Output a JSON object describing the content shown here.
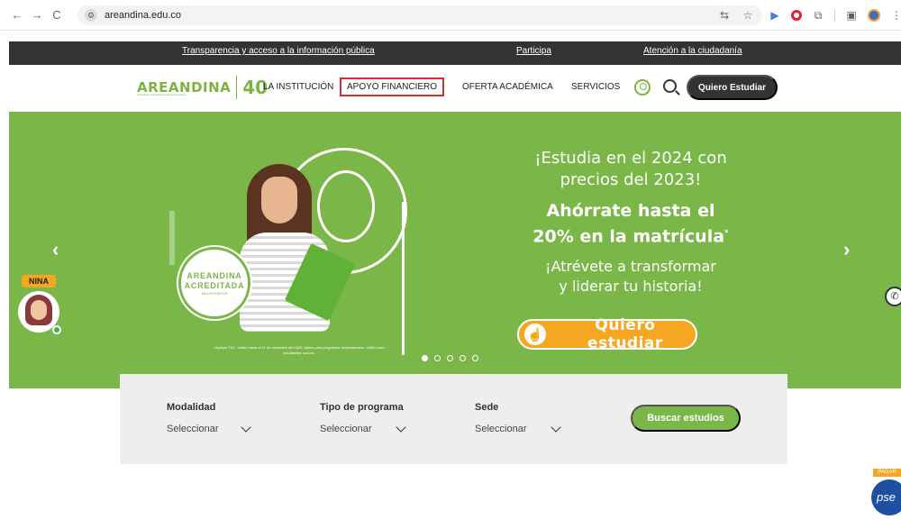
{
  "browser": {
    "url": "areandina.edu.co",
    "back_glyph": "←",
    "forward_glyph": "→",
    "reload_glyph": "C",
    "star_glyph": "☆",
    "menu_glyph": "⋮"
  },
  "top_bar": {
    "links": [
      "Transparencia y acceso a la información pública",
      "Participa",
      "Atención a la ciudadanía"
    ]
  },
  "header": {
    "logo_text": "AREANDINA",
    "logo_subtext": "Fundación Universitaria del Área Andina",
    "logo_anniversary": "40",
    "menu": [
      "LA INSTITUCIÓN",
      "APOYO FINANCIERO",
      "OFERTA ACADÉMICA",
      "SERVICIOS"
    ],
    "cta_label": "Quiero Estudiar"
  },
  "hero": {
    "headline_1a": "¡Estudia en el 2024 con",
    "headline_1b": "precios del 2023!",
    "headline_2a": "Ahórrate hasta el",
    "headline_2b": "20% en la matrícula",
    "headline_2_mark": "*",
    "headline_3a": "¡Atrévete a transformar",
    "headline_3b": "y liderar tu historia!",
    "cta_label": "Quiero estudiar",
    "seal_line1": "AREANDINA",
    "seal_line2": "ACREDITADA",
    "seal_line3": "MULTICAMPUS",
    "legal": "*Aplican T&C. Válido hasta el 11 de diciembre del 2023. Aplica para programas seleccionados. Válido para estudiantes nuevos.",
    "prev_glyph": "‹",
    "next_glyph": "›",
    "slides_total": 5,
    "active_slide": 1
  },
  "nina": {
    "label": "NINA"
  },
  "search": {
    "fields": [
      {
        "label": "Modalidad",
        "value": "Seleccionar"
      },
      {
        "label": "Tipo de programa",
        "value": "Seleccionar"
      },
      {
        "label": "Sede",
        "value": "Seleccionar"
      }
    ],
    "button_label": "Buscar estudios"
  },
  "pse": {
    "tag": "PAGAR",
    "label": "pse"
  },
  "colors": {
    "brand_green": "#7ab648",
    "dark_bar": "#333333",
    "accent_orange": "#f5a623",
    "highlight_red": "#d32f2f"
  }
}
